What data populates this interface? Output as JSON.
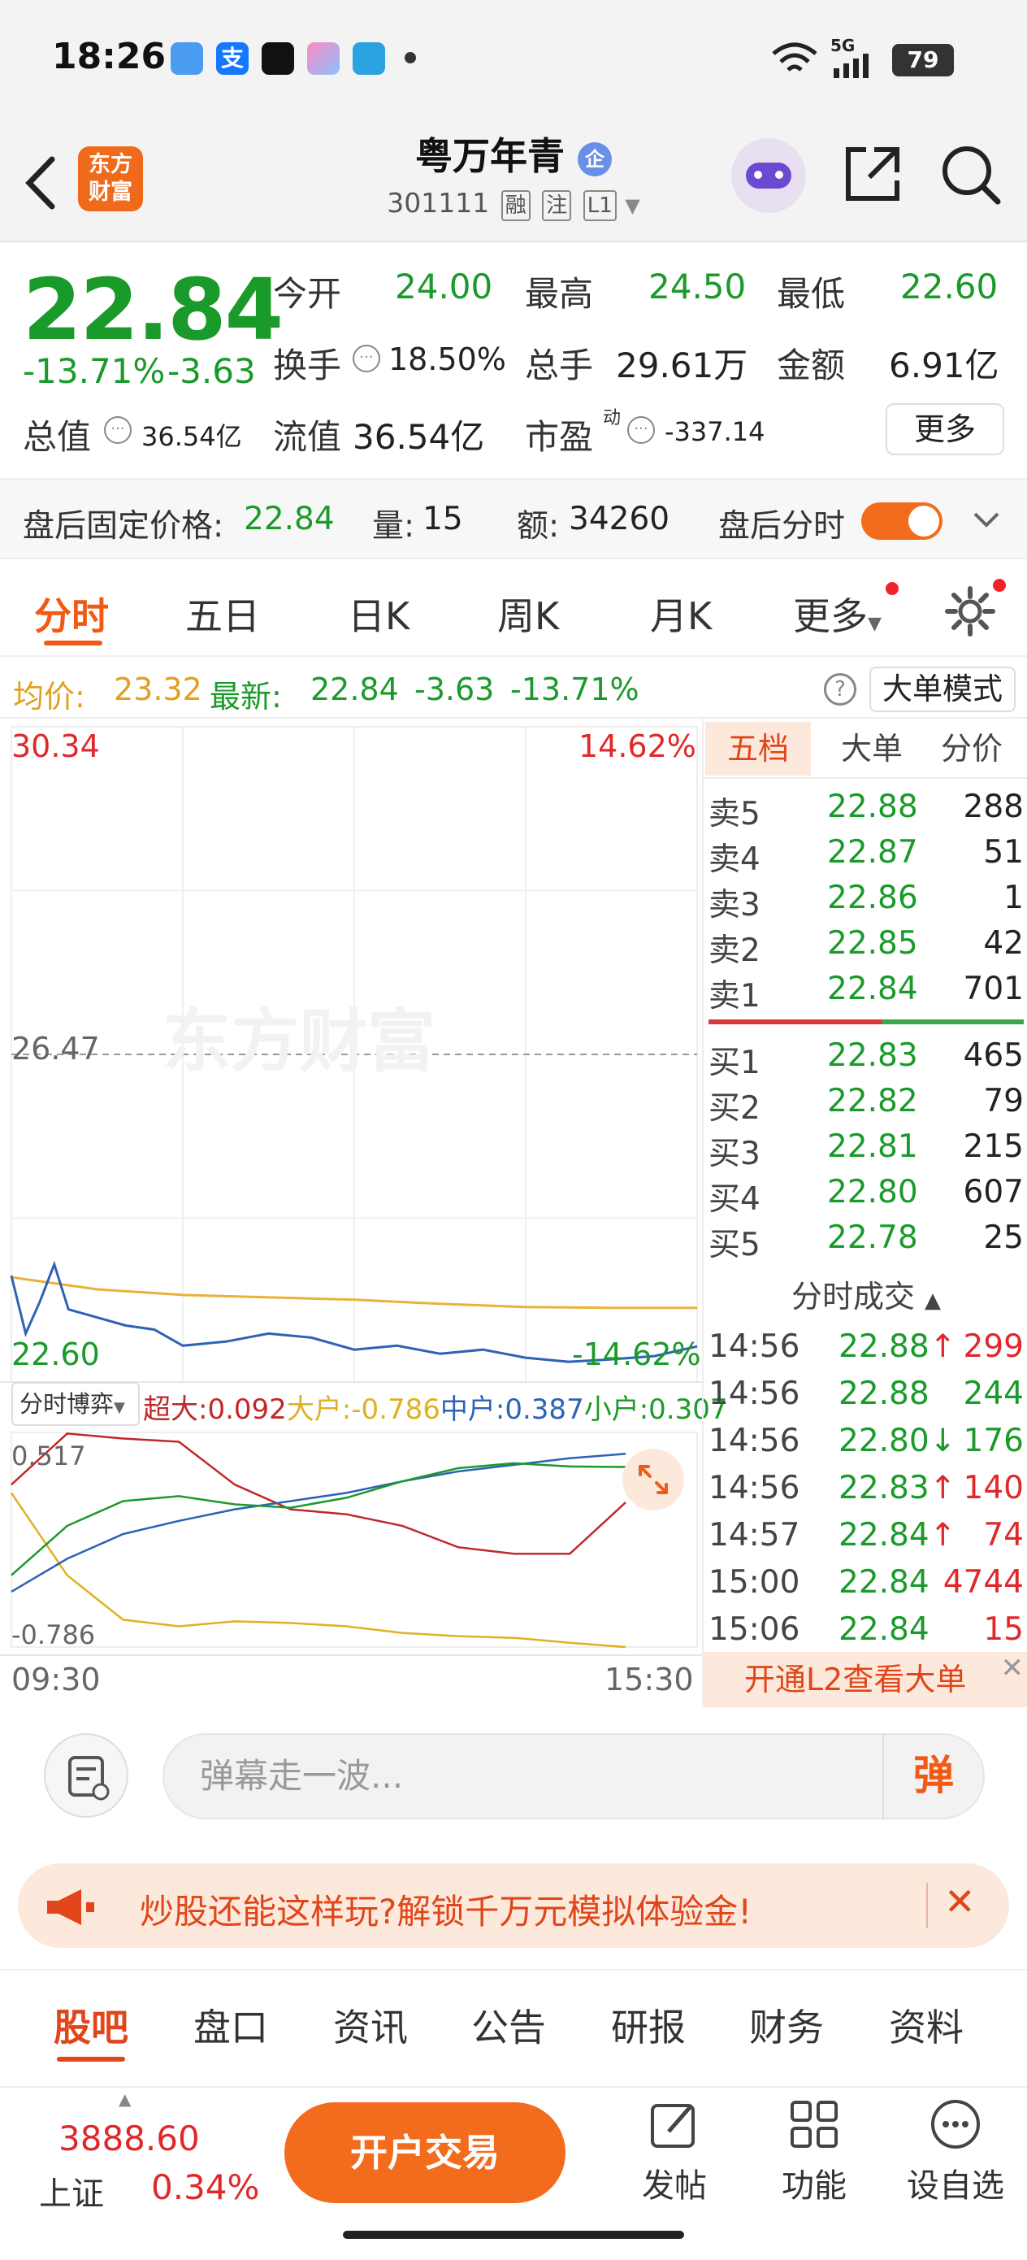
{
  "status_bar": {
    "time": "18:26",
    "network": "5G",
    "battery": "79",
    "app_icons": [
      {
        "name": "weather-app-icon",
        "color": "#4a9cf0"
      },
      {
        "name": "alipay-app-icon",
        "color": "#1677ff"
      },
      {
        "name": "tiktok-app-icon",
        "color": "#111111"
      },
      {
        "name": "photos-app-icon",
        "color": "#ff8ac0"
      },
      {
        "name": "telegram-app-icon",
        "color": "#2aa3e0"
      }
    ]
  },
  "header": {
    "logo_text_1": "东方",
    "logo_text_2": "财富",
    "stock_name": "粤万年青",
    "stock_code": "301111",
    "tags": [
      "融",
      "注",
      "L1"
    ],
    "badge": "企"
  },
  "quote": {
    "price": "22.84",
    "change_pct": "-13.71%",
    "change": "-3.63",
    "open_label": "今开",
    "open": "24.00",
    "high_label": "最高",
    "high": "24.50",
    "low_label": "最低",
    "low": "22.60",
    "turnover_label": "换手",
    "turnover": "18.50%",
    "volume_label": "总手",
    "volume": "29.61万",
    "amount_label": "金额",
    "amount": "6.91亿",
    "mktcap_label": "总值",
    "mktcap": "36.54亿",
    "float_label": "流值",
    "float": "36.54亿",
    "pe_label": "市盈",
    "pe_sup": "动",
    "pe": "-337.14",
    "more_label": "更多"
  },
  "after_hours": {
    "fixed_price_label": "盘后固定价格:",
    "fixed_price": "22.84",
    "vol_label": "量:",
    "vol": "15",
    "amt_label": "额:",
    "amt": "34260",
    "toggle_label": "盘后分时"
  },
  "tabs": [
    "分时",
    "五日",
    "日K",
    "周K",
    "月K",
    "更多"
  ],
  "avg_bar": {
    "avg_label": "均价:",
    "avg": "23.32",
    "latest_label": "最新:",
    "latest": "22.84",
    "change": "-3.63",
    "change_pct": "-13.71%",
    "help": "?",
    "mode_button": "大单模式"
  },
  "chart": {
    "watermark": "东方财富",
    "top_left": "30.34",
    "top_right": "14.62%",
    "mid": "26.47",
    "bottom_left": "22.60",
    "bottom_right": "-14.62%",
    "time_start": "09:30",
    "time_end": "15:30",
    "colors": {
      "price": "#2d62b5",
      "avg": "#e8b23a",
      "super": "#c0282a",
      "big": "#e0b020",
      "mid": "#2d62b5",
      "small": "#1a9a2a"
    }
  },
  "chart_data": [
    {
      "type": "line",
      "x_range": [
        "09:30",
        "15:30"
      ],
      "ylim": [
        22.6,
        30.34
      ],
      "reference_price": 26.47,
      "series": [
        {
          "name": "均价",
          "x": [
            "09:30",
            "10:00",
            "10:30",
            "11:30",
            "13:30",
            "14:00",
            "14:30",
            "15:00"
          ],
          "values": [
            23.7,
            23.55,
            23.48,
            23.42,
            23.37,
            23.33,
            23.32,
            23.32
          ]
        },
        {
          "name": "最新",
          "x": [
            "09:30",
            "09:35",
            "09:40",
            "09:45",
            "09:50",
            "10:00",
            "10:10",
            "10:20",
            "10:30",
            "10:45",
            "11:00",
            "11:15",
            "11:30",
            "13:15",
            "13:30",
            "13:45",
            "14:00",
            "14:15",
            "14:30",
            "14:45",
            "15:00"
          ],
          "values": [
            23.72,
            23.0,
            23.4,
            23.86,
            23.3,
            23.2,
            23.1,
            23.05,
            22.85,
            22.9,
            23.0,
            22.95,
            22.8,
            22.85,
            22.75,
            22.8,
            22.7,
            22.65,
            22.68,
            22.72,
            22.84
          ]
        }
      ]
    },
    {
      "type": "line",
      "title": "分时博弈",
      "ylim": [
        -0.786,
        0.517
      ],
      "x_range": [
        "09:30",
        "15:30"
      ],
      "series": [
        {
          "name": "超大",
          "values": [
            0.2,
            0.51,
            0.48,
            0.46,
            0.2,
            0.05,
            0.02,
            -0.05,
            -0.18,
            -0.22,
            -0.22,
            0.092
          ]
        },
        {
          "name": "大户",
          "values": [
            0.15,
            -0.35,
            -0.62,
            -0.66,
            -0.63,
            -0.64,
            -0.66,
            -0.7,
            -0.72,
            -0.73,
            -0.76,
            -0.786
          ]
        },
        {
          "name": "中户",
          "values": [
            -0.45,
            -0.25,
            -0.1,
            -0.02,
            0.05,
            0.1,
            0.15,
            0.22,
            0.28,
            0.32,
            0.36,
            0.387
          ]
        },
        {
          "name": "小户",
          "values": [
            -0.35,
            -0.05,
            0.1,
            0.13,
            0.08,
            0.06,
            0.12,
            0.22,
            0.3,
            0.33,
            0.31,
            0.307
          ]
        }
      ]
    }
  ],
  "game": {
    "selector": "分时博弈",
    "super_label": "超大:",
    "super": "0.092",
    "big_label": "大户:",
    "big": "-0.786",
    "mid_label": "中户:",
    "mid": "0.387",
    "small_label": "小户:",
    "small": "0.307",
    "top": "0.517",
    "bottom": "-0.786"
  },
  "orderbook": {
    "tabs": [
      "五档",
      "大单",
      "分价"
    ],
    "asks": [
      {
        "label": "卖5",
        "price": "22.88",
        "vol": "288"
      },
      {
        "label": "卖4",
        "price": "22.87",
        "vol": "51"
      },
      {
        "label": "卖3",
        "price": "22.86",
        "vol": "1"
      },
      {
        "label": "卖2",
        "price": "22.85",
        "vol": "42"
      },
      {
        "label": "卖1",
        "price": "22.84",
        "vol": "701"
      }
    ],
    "bids": [
      {
        "label": "买1",
        "price": "22.83",
        "vol": "465"
      },
      {
        "label": "买2",
        "price": "22.82",
        "vol": "79"
      },
      {
        "label": "买3",
        "price": "22.81",
        "vol": "215"
      },
      {
        "label": "买4",
        "price": "22.80",
        "vol": "607"
      },
      {
        "label": "买5",
        "price": "22.78",
        "vol": "25"
      }
    ],
    "trades_title": "分时成交",
    "trades": [
      {
        "time": "14:56",
        "price": "22.88",
        "arrow": "↑",
        "vol": "299",
        "color": "red"
      },
      {
        "time": "14:56",
        "price": "22.88",
        "arrow": "",
        "vol": "244",
        "color": "green"
      },
      {
        "time": "14:56",
        "price": "22.80",
        "arrow": "↓",
        "vol": "176",
        "color": "green"
      },
      {
        "time": "14:56",
        "price": "22.83",
        "arrow": "↑",
        "vol": "140",
        "color": "red"
      },
      {
        "time": "14:57",
        "price": "22.84",
        "arrow": "↑",
        "vol": "74",
        "color": "red"
      },
      {
        "time": "15:00",
        "price": "22.84",
        "arrow": "",
        "vol": "4744",
        "color": "red"
      },
      {
        "time": "15:06",
        "price": "22.84",
        "arrow": "",
        "vol": "15",
        "color": "red"
      }
    ],
    "l2_banner": "开通L2查看大单"
  },
  "comment": {
    "placeholder": "弹幕走一波...",
    "danmu": "弹"
  },
  "promo": {
    "text": "炒股还能这样玩?解锁千万元模拟体验金!"
  },
  "subtabs": [
    "股吧",
    "盘口",
    "资讯",
    "公告",
    "研报",
    "财务",
    "资料"
  ],
  "bottom": {
    "index_value": "3888.60",
    "index_name": "上证",
    "index_change": "0.34%",
    "trade_button": "开户交易",
    "post": "发帖",
    "function": "功能",
    "watch": "设自选"
  }
}
